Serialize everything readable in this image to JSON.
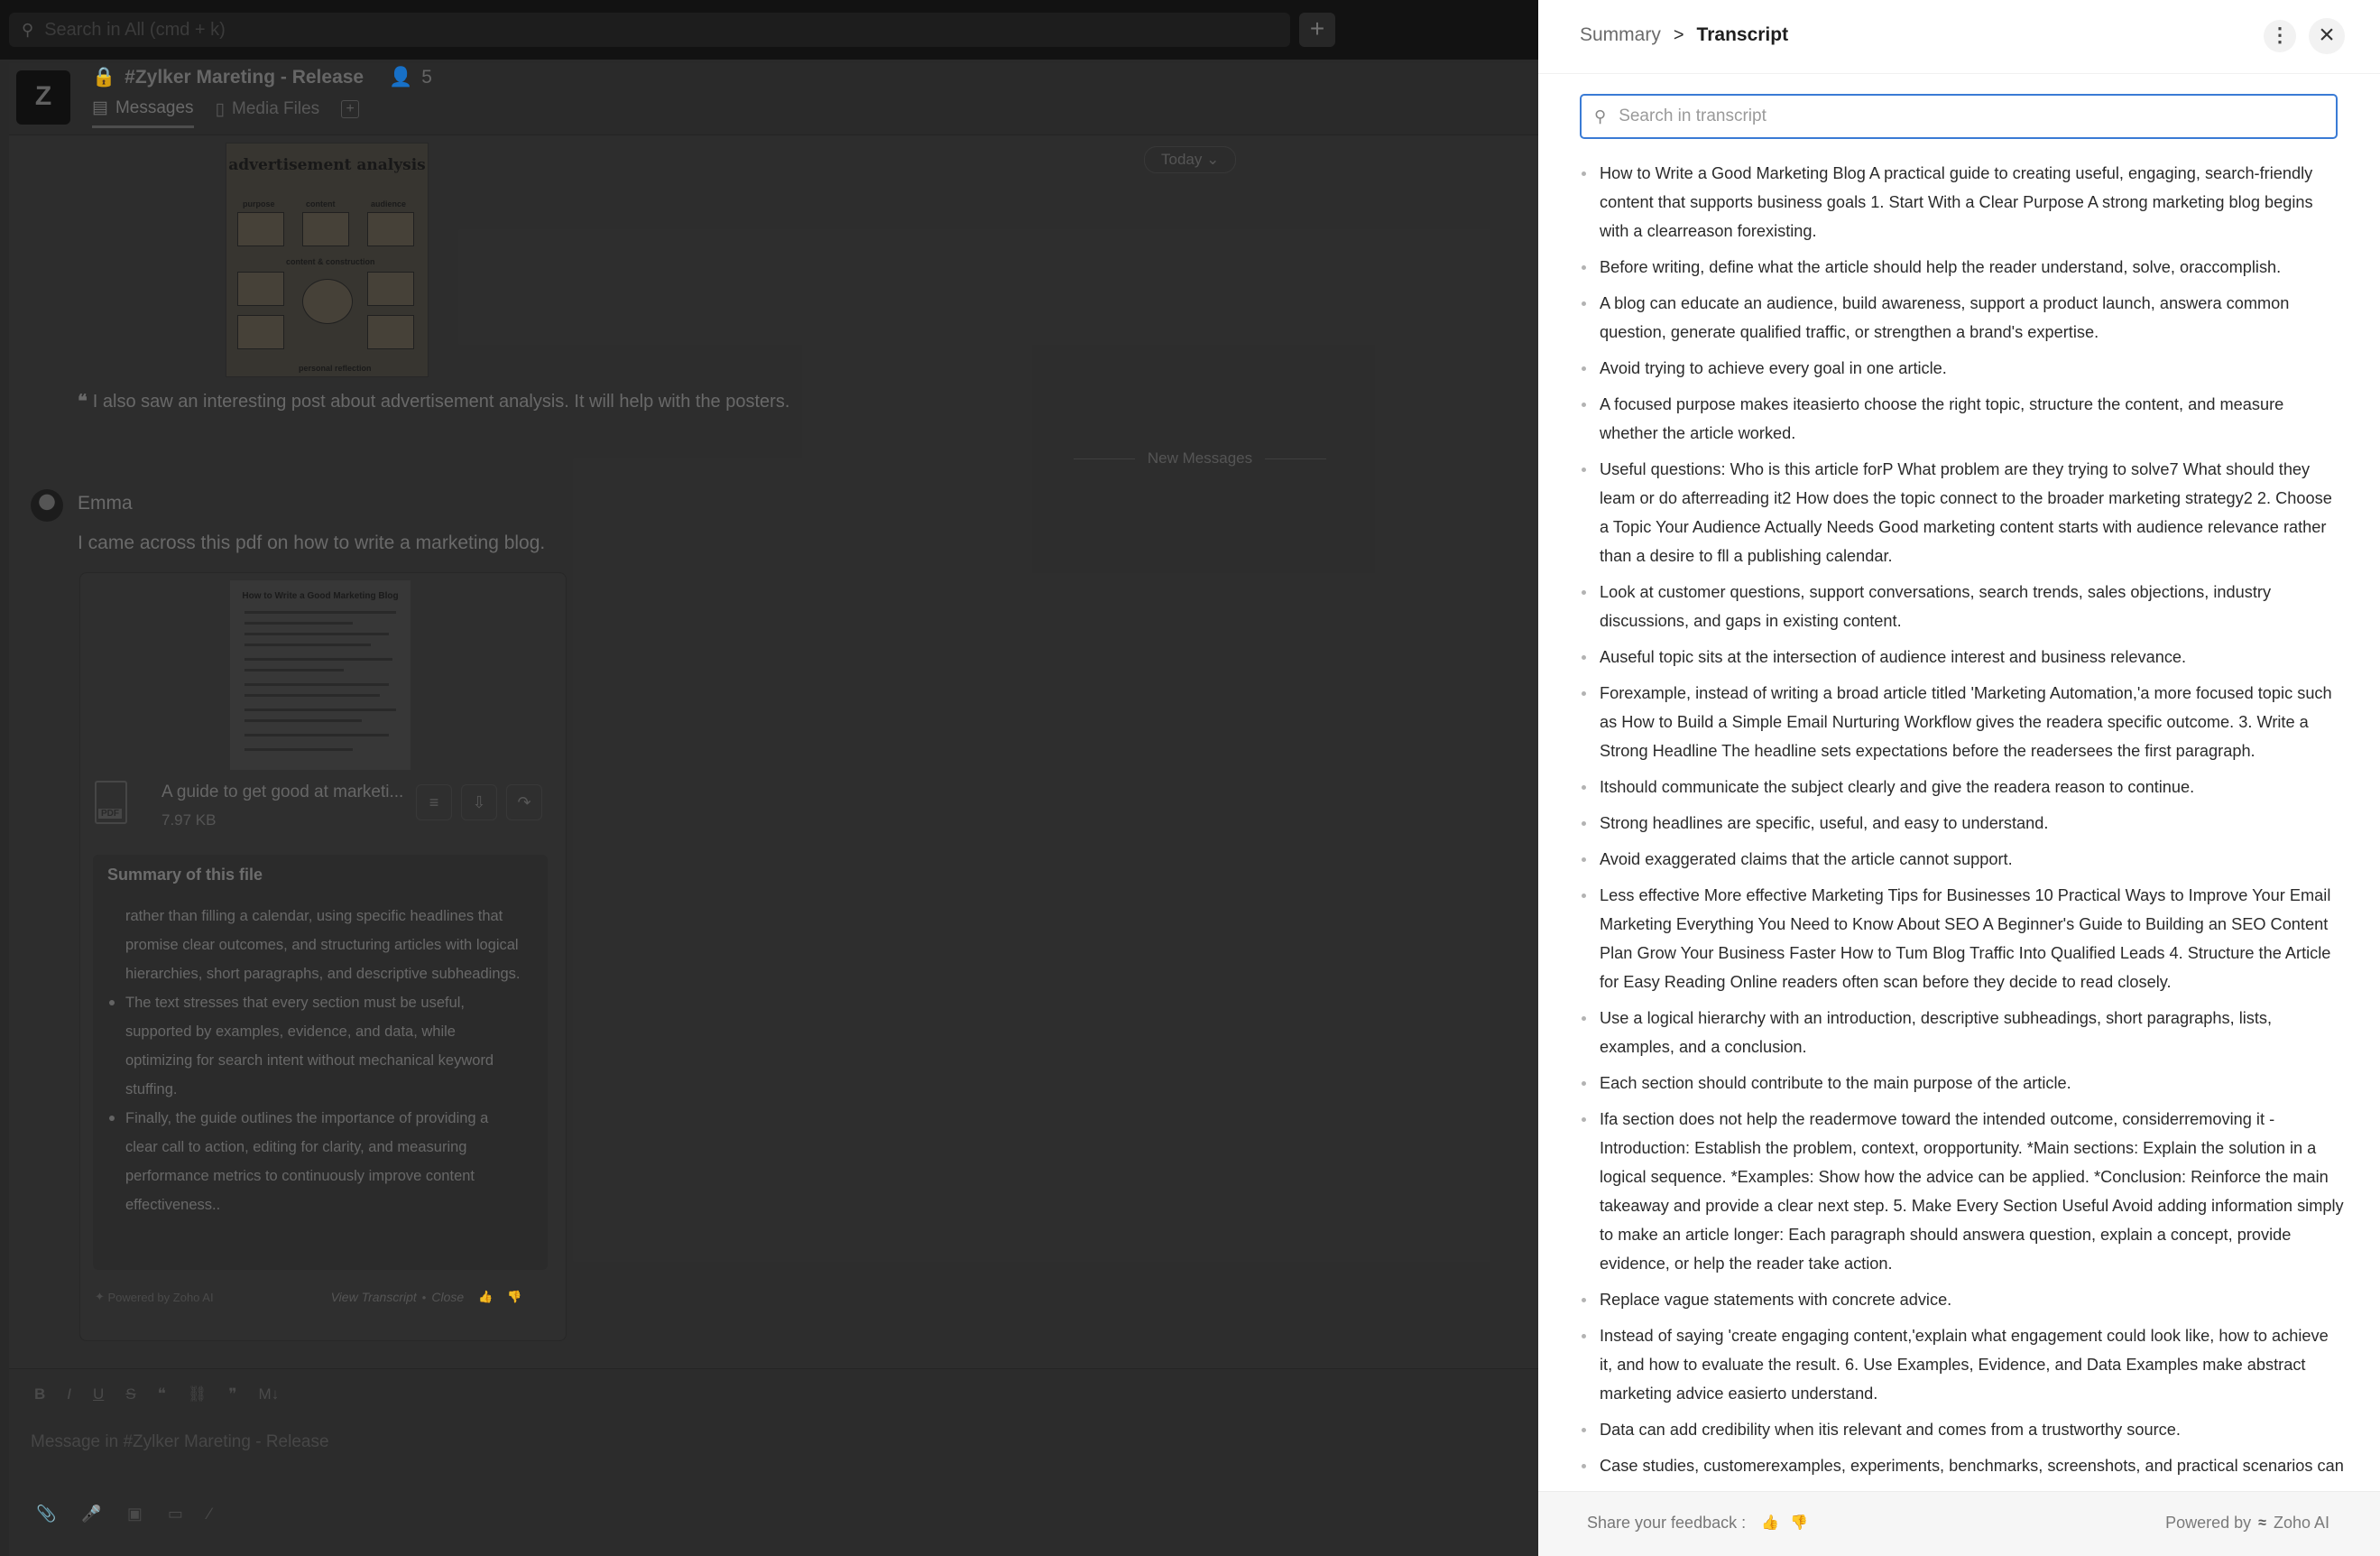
{
  "app": {
    "search_placeholder": "Search in All (cmd + k)",
    "add_icon": "plus-icon"
  },
  "channel": {
    "logo_text": "Z",
    "name": "#Zylker Mareting - Release",
    "member_count": "5",
    "tabs": [
      {
        "label": "Messages"
      },
      {
        "label": "Media Files"
      }
    ]
  },
  "chat": {
    "image_title": "advertisement analysis",
    "image_labels": [
      "purpose",
      "content",
      "audience",
      "content & construction",
      "personal reflection"
    ],
    "today_label": "Today",
    "quote_text": "I also saw an interesting post about advertisement analysis. It will help with the posters.",
    "new_messages_label": "New Messages",
    "author": "Emma",
    "message": "I came across this pdf on how to write a marketing blog.",
    "pdf_preview_title": "How to Write a Good Marketing Blog",
    "file_name": "A guide to get good at marketi...",
    "file_size": "7.97 KB",
    "file_type": "PDF",
    "summary_title": "Summary of this file",
    "summary_points": [
      "rather than filling a calendar, using specific headlines that promise clear outcomes, and structuring articles with logical hierarchies, short paragraphs, and descriptive subheadings.",
      "The text stresses that every section must be useful, supported by examples, evidence, and data, while optimizing for search intent without mechanical keyword stuffing.",
      "Finally, the guide outlines the importance of providing a clear call to action, editing for clarity, and measuring performance metrics to continuously improve content effectiveness.."
    ],
    "powered_by": "Powered by Zoho AI",
    "view_transcript": "View Transcript",
    "close_label": "Close"
  },
  "composer": {
    "placeholder": "Message in #Zylker Mareting - Release",
    "format_tools": [
      "B",
      "I",
      "U",
      "S",
      "❝",
      "⛓",
      "❞",
      "M↓"
    ]
  },
  "panel": {
    "breadcrumb_parent": "Summary",
    "breadcrumb_separator": ">",
    "breadcrumb_current": "Transcript",
    "search_placeholder": "Search in transcript",
    "transcript": [
      "How to Write a Good Marketing Blog A practical guide to creating useful, engaging, search-friendly content that supports business goals 1. Start With a Clear Purpose A strong marketing blog begins with a clearreason forexisting.",
      "Before writing, define what the article should help the reader understand, solve, oraccomplish.",
      "A blog can educate an audience, build awareness, support a product launch, answera common question, generate qualified traffic, or strengthen a brand's expertise.",
      "Avoid trying to achieve every goal in one article.",
      "A focused purpose makes iteasierto choose the right topic, structure the content, and measure whether the article worked.",
      "Useful questions: Who is this article forP What problem are they trying to solve7 What should they leam or do afterreading it2 How does the topic connect to the broader marketing strategy2 2. Choose a Topic Your Audience Actually Needs Good marketing content starts with audience relevance rather than a desire to fll a publishing calendar.",
      "Look at customer questions, support conversations, search trends, sales objections, industry discussions, and gaps in existing content.",
      "Auseful topic sits at the intersection of audience interest and business relevance.",
      "Forexample, instead of writing a broad article titled 'Marketing Automation,'a more focused topic such as How to Build a Simple Email Nurturing Workflow gives the readera specific outcome. 3. Write a Strong Headline The headline sets expectations before the readersees the first paragraph.",
      "Itshould communicate the subject clearly and give the readera reason to continue.",
      "Strong headlines are specific, useful, and easy to understand.",
      "Avoid exaggerated claims that the article cannot support.",
      "Less effective More effective Marketing Tips for Businesses 10 Practical Ways to Improve Your Email Marketing Everything You Need to Know About SEO A Beginner's Guide to Building an SEO Content Plan Grow Your Business Faster How to Tum Blog Traffic Into Qualified Leads 4. Structure the Article for Easy Reading Online readers often scan before they decide to read closely.",
      "Use a logical hierarchy with an introduction, descriptive subheadings, short paragraphs, lists, examples, and a conclusion.",
      "Each section should contribute to the main purpose of the article.",
      "Ifa section does not help the readermove toward the intended outcome, considerremoving it - Introduction: Establish the problem, context, oropportunity. *Main sections: Explain the solution in a logical sequence. *Examples: Show how the advice can be applied. *Conclusion: Reinforce the main takeaway and provide a clear next step. 5. Make Every Section Useful Avoid adding information simply to make an article longer: Each paragraph should answera question, explain a concept, provide evidence, or help the reader take action.",
      "Replace vague statements with concrete advice.",
      "Instead of saying 'create engaging content,'explain what engagement could look like, how to achieve it, and how to evaluate the result. 6. Use Examples, Evidence, and Data Examples make abstract marketing advice easierto understand.",
      "Data can add credibility when itis relevant and comes from a trustworthy source.",
      "Case studies, customerexamples, experiments, benchmarks, screenshots, and practical scenarios can"
    ],
    "feedback_label": "Share your feedback :",
    "powered_by_prefix": "Powered by",
    "powered_by_brand": "Zoho AI",
    "accent_color": "#3a7bd5"
  }
}
